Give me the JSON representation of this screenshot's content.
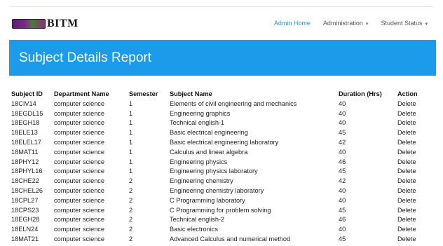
{
  "brand": {
    "name": "BITM",
    "logo_icon": "college-logo-icon"
  },
  "nav": {
    "admin_home": "Admin Home",
    "administration": "Administration",
    "student_status": "Student Status",
    "caret_glyph": "▾"
  },
  "colors": {
    "accent": "#1b9bea",
    "link": "#2f8fd6"
  },
  "page": {
    "title": "Subject Details Report"
  },
  "table": {
    "headers": [
      "Subject ID",
      "Department Name",
      "Semester",
      "Subject Name",
      "Duration (Hrs)",
      "Action"
    ],
    "rows": [
      [
        "18CIV14",
        "computer science",
        "1",
        "Elements of civil engineering and mechanics",
        "40",
        "Delete"
      ],
      [
        "18EGDL15",
        "computer science",
        "1",
        "Engineering graphics",
        "40",
        "Delete"
      ],
      [
        "18EGH18",
        "computer science",
        "1",
        "Technical english-1",
        "40",
        "Delete"
      ],
      [
        "18ELE13",
        "computer science",
        "1",
        "Basic electrical engineering",
        "45",
        "Delete"
      ],
      [
        "18ELEL17",
        "computer science",
        "1",
        "Basic electrical engineering laboratory",
        "42",
        "Delete"
      ],
      [
        "18MAT11",
        "computer science",
        "1",
        "Calculus and linear algebra",
        "40",
        "Delete"
      ],
      [
        "18PHY12",
        "computer science",
        "1",
        "Engineering physics",
        "46",
        "Delete"
      ],
      [
        "18PHYL16",
        "computer science",
        "1",
        "Engineering physics laboratory",
        "45",
        "Delete"
      ],
      [
        "18CHE22",
        "computer science",
        "2",
        "Engineering chemistry",
        "42",
        "Delete"
      ],
      [
        "18CHEL26",
        "computer science",
        "2",
        "Engineering chemistry laboratory",
        "40",
        "Delete"
      ],
      [
        "18CPL27",
        "computer science",
        "2",
        "C Programming laboratory",
        "40",
        "Delete"
      ],
      [
        "18CPS23",
        "computer science",
        "2",
        "C Programming for problem solving",
        "45",
        "Delete"
      ],
      [
        "18EGH28",
        "computer science",
        "2",
        "Technical english-2",
        "46",
        "Delete"
      ],
      [
        "18ELN24",
        "computer science",
        "2",
        "Basic electronics",
        "40",
        "Delete"
      ],
      [
        "18MAT21",
        "computer science",
        "2",
        "Advanced Calculus and numerical method",
        "45",
        "Delete"
      ]
    ]
  }
}
